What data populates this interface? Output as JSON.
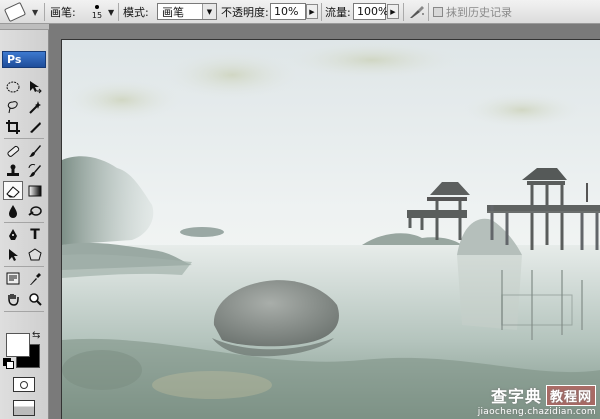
{
  "options_bar": {
    "tool_preset_icon": "eraser-icon",
    "brush_label": "画笔:",
    "brush_size": "15",
    "mode_label": "模式:",
    "mode_value": "画笔",
    "opacity_label": "不透明度:",
    "opacity_value": "10%",
    "flow_label": "流量:",
    "flow_value": "100%",
    "airbrush_icon": "airbrush-icon",
    "erase_to_history_label": "抹到历史记录",
    "erase_to_history_checked": false
  },
  "toolbox": {
    "logo": "Ps",
    "tools": [
      "marquee-icon",
      "move-icon",
      "lasso-icon",
      "magic-wand-icon",
      "crop-icon",
      "slice-icon",
      "healing-brush-icon",
      "brush-icon",
      "clone-stamp-icon",
      "history-brush-icon",
      "eraser-icon",
      "gradient-icon",
      "blur-icon",
      "dodge-icon",
      "pen-icon",
      "type-icon",
      "path-selection-icon",
      "shape-icon",
      "notes-icon",
      "eyedropper-icon",
      "hand-icon",
      "zoom-icon"
    ],
    "active_tool": "eraser-icon",
    "foreground_color": "#ffffff",
    "background_color": "#000000"
  },
  "watermark": {
    "main": "查字典",
    "tag": "教程网",
    "url": "jiaocheng.chazidian.com"
  }
}
